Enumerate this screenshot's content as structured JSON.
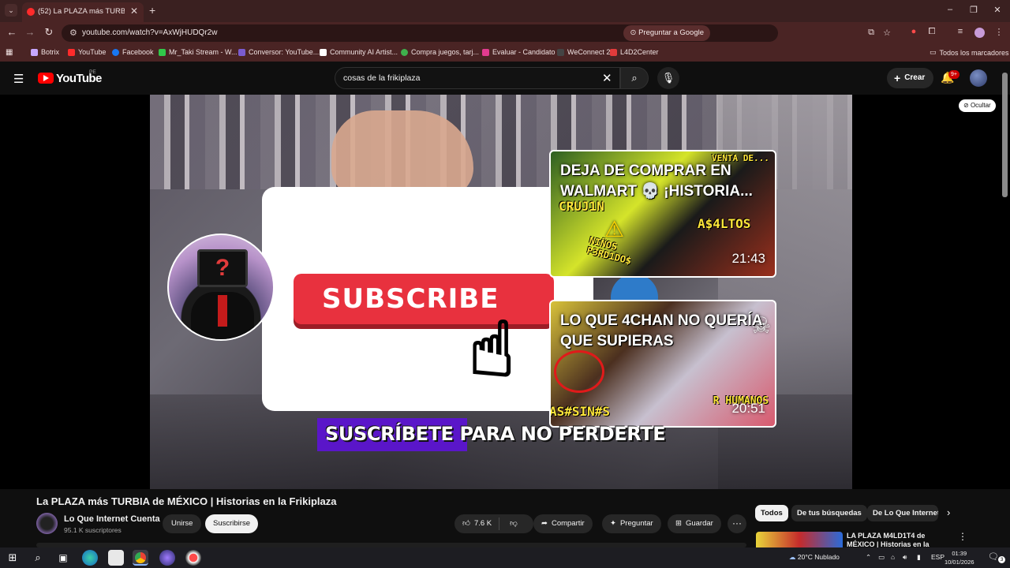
{
  "browser": {
    "tab_title": "(52) La PLAZA más TURBIA de M",
    "url": "youtube.com/watch?v=AxWjHUDQr2w",
    "ask_google_label": "Preguntar a Google",
    "bookmarks": [
      "Botrix",
      "YouTube",
      "Facebook",
      "Mr_Taki Stream - W...",
      "Conversor: YouTube...",
      "Community AI Artist...",
      "Compra juegos, tarj...",
      "Evaluar - Candidato",
      "WeConnect 2.0",
      "L4D2Center"
    ],
    "all_bookmarks_label": "Todos los marcadores",
    "bookmark_colors": [
      "#c6a7ff",
      "#ff2b2b",
      "#1877f2",
      "#31c94a",
      "#7a5ccf",
      "#ffffff",
      "#3fb04c",
      "#e23b8f",
      "#444444",
      "#e23b3b"
    ]
  },
  "youtube": {
    "wordmark": "YouTube",
    "region": "PE",
    "search_query": "cosas de la frikiplaza",
    "create_label": "Crear",
    "notifications_badge": "9+"
  },
  "video": {
    "hide_label": "Ocultar",
    "subscribe_graphic_text": "SUBSCRIBE",
    "banner_text": "SUSCRÍBETE PARA NO PERDERTE",
    "end_cards": [
      {
        "title": "DEJA DE COMPRAR EN WALMART 💀 ¡HISTORIA...",
        "duration": "21:43",
        "tags": [
          "CRUJ1N",
          "A$4LTOS",
          "NIÑOS P3RD1DO$",
          "VENTA DE..."
        ]
      },
      {
        "title": "LO QUE 4CHAN NO QUERÍA QUE SUPIERAS",
        "duration": "20:51",
        "tags": [
          "AS#SIN#S",
          "R HUMANOS"
        ]
      }
    ]
  },
  "below": {
    "title": "La PLAZA más TURBIA de MÉXICO | Historias en la Frikiplaza",
    "channel_name": "Lo Que Internet Cuenta",
    "subscribers": "95.1 K suscriptores",
    "join_label": "Unirse",
    "subscribe_label": "Suscribirse",
    "likes": "7.6 K",
    "share_label": "Compartir",
    "ask_label": "Preguntar",
    "save_label": "Guardar",
    "chips": [
      "Todos",
      "De tus búsquedas",
      "De Lo Que Internet"
    ],
    "related_title": "LA PLAZA M4LD1T4 de MÉXICO | Historias en la"
  },
  "taskbar": {
    "weather": "20°C  Nublado",
    "lang": "ESP",
    "time": "01:39",
    "date": "10/01/2026",
    "notif_count": "3"
  }
}
